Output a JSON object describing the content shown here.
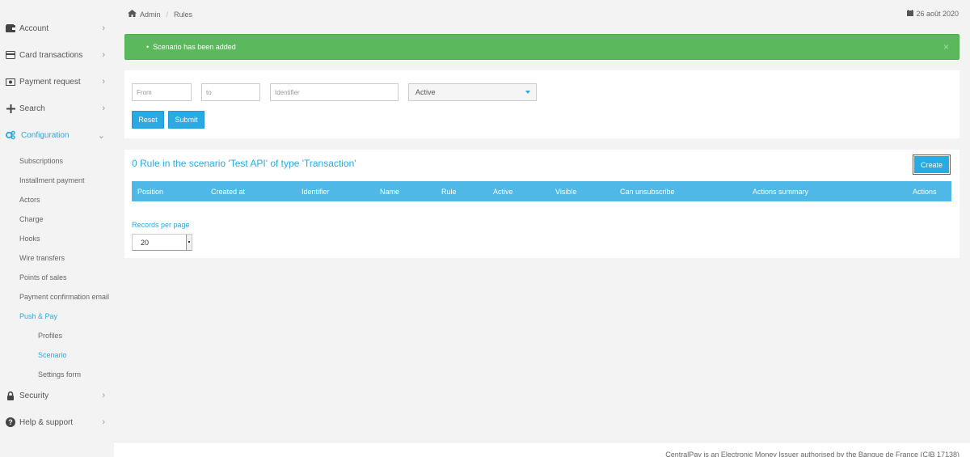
{
  "sidebar": {
    "items": [
      {
        "label": "Account",
        "icon": "wallet-icon"
      },
      {
        "label": "Card transactions",
        "icon": "credit-card-icon"
      },
      {
        "label": "Payment request",
        "icon": "money-bill-icon"
      },
      {
        "label": "Search",
        "icon": "plus-icon"
      },
      {
        "label": "Configuration",
        "icon": "cogs-icon"
      },
      {
        "label": "Security",
        "icon": "lock-icon"
      },
      {
        "label": "Help & support",
        "icon": "question-circle-icon"
      }
    ],
    "configuration_sub": [
      "Subscriptions",
      "Installment payment",
      "Actors",
      "Charge",
      "Hooks",
      "Wire transfers",
      "Points of sales",
      "Payment confirmation email",
      "Push & Pay"
    ],
    "push_pay_sub": [
      "Profiles",
      "Scenario",
      "Settings form"
    ],
    "active_item": "Configuration",
    "active_subsub": "Scenario"
  },
  "breadcrumb": {
    "home": "Admin",
    "current": "Rules"
  },
  "date": "26 août 2020",
  "alert": {
    "message": "Scenario has been added",
    "close": "×"
  },
  "filters": {
    "from_placeholder": "From",
    "to_placeholder": "to",
    "identifier_placeholder": "Identifier",
    "status_selected": "Active",
    "reset_label": "Reset",
    "submit_label": "Submit"
  },
  "rules": {
    "title": "0 Rule in the scenario 'Test API' of type 'Transaction'",
    "create_label": "Create",
    "columns": [
      "Position",
      "Created at",
      "Identifier",
      "Name",
      "Rule",
      "Active",
      "Visible",
      "Can unsubscribe",
      "Actions summary",
      "Actions"
    ],
    "records_per_page_label": "Records per page",
    "records_per_page_value": "20"
  },
  "footer": {
    "text": "CentralPay is an Electronic Money Issuer authorised by the Banque de France (CIB 17138)"
  },
  "colors": {
    "accent": "#29aae3",
    "success": "#5cb85c",
    "table_header": "#4fb8e6"
  }
}
